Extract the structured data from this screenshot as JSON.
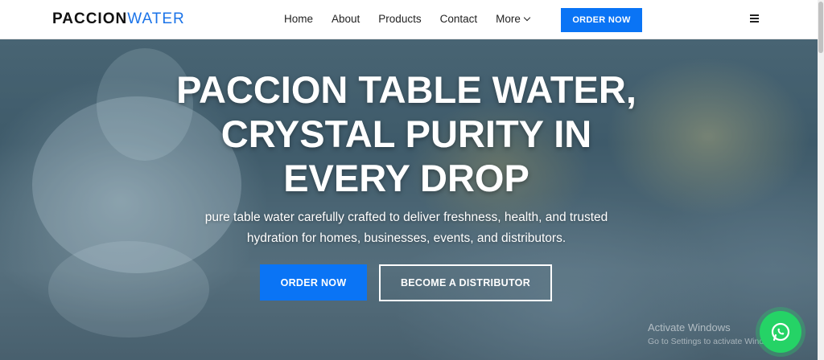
{
  "navbar": {
    "brand_primary": "PACCION",
    "brand_secondary": "WATER",
    "links": [
      "Home",
      "About",
      "Products",
      "Contact",
      "More"
    ],
    "order_button": "ORDER NOW",
    "menu_icon": "hamburger-icon"
  },
  "hero": {
    "headline_line1": "PACCION TABLE WATER,",
    "headline_line2": "CRYSTAL PURITY IN",
    "headline_line3": "EVERY DROP",
    "subtext_line1": "pure table water carefully crafted to deliver freshness, health, and trusted",
    "subtext_line2": "hydration for homes, businesses, events, and distributors.",
    "order_button": "ORDER NOW",
    "distributor_button": "BECOME A DISTRIBUTOR"
  },
  "overlay": {
    "activation_title": "Activate Windows",
    "activation_sub": "Go to Settings to activate Windows.",
    "whatsapp_icon": "whatsapp-icon"
  },
  "colors": {
    "accent": "#0a74f5",
    "whatsapp": "#25d366"
  }
}
